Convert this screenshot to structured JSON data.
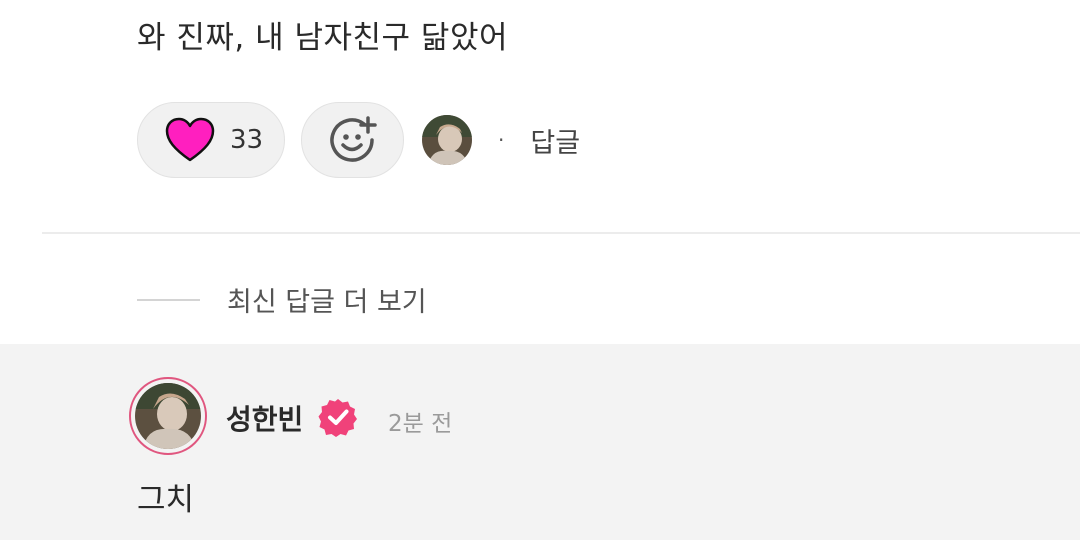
{
  "comment": {
    "text": "와 진짜, 내 남자친구 닮았어",
    "like_count": "33",
    "separator": "·",
    "reply_label": "답글"
  },
  "thread": {
    "more_replies_label": "최신 답글 더 보기"
  },
  "reply": {
    "author": "성한빈",
    "time": "2분 전",
    "text": "그치"
  },
  "icons": {
    "like": "heart-icon",
    "add_reaction": "add-emoji-icon",
    "verified": "verified-badge-icon"
  },
  "colors": {
    "heart": "#ff1fbf",
    "verified_badge": "#f0427a",
    "avatar_ring": "#e0567f",
    "reply_background": "#f3f3f3"
  }
}
